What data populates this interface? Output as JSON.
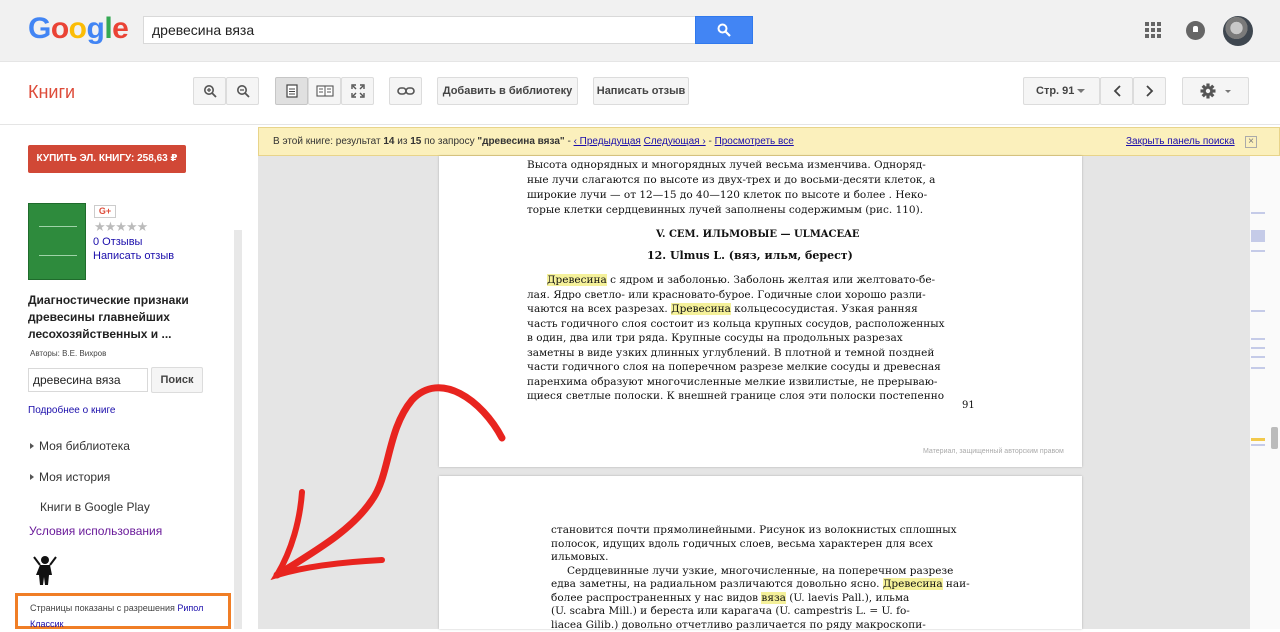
{
  "header": {
    "search_value": "древесина вяза"
  },
  "toolbar": {
    "section_title": "Книги",
    "add_library": "Добавить в библиотеку",
    "write_review": "Написать отзыв",
    "page_label": "Стр. 91"
  },
  "sidebar": {
    "buy_button": "КУПИТЬ ЭЛ. КНИГУ: 258,63 ₽",
    "gplus": "G+",
    "stars": "★★★★★",
    "reviews_count": "0 Отзывы",
    "write_review": "Написать отзыв",
    "book_title": "Диагностические признаки древесины главнейших лесохозяйственных и ...",
    "authors": "Авторы: В.Е. Вихров",
    "search_value": "древесина вяза",
    "search_button": "Поиск",
    "about_link": "Подробнее о книге",
    "nav": [
      "Моя библиотека",
      "Моя история",
      "Книги в Google Play"
    ],
    "terms": "Условия использования",
    "permission_text": "Страницы показаны с разрешения",
    "publisher": "Рипол Классик"
  },
  "results_bar": {
    "prefix": "В этой книге: результат",
    "current": "14",
    "of": "из",
    "total": "15",
    "query_prefix": "по запросу",
    "query": "\"древесина вяза\"",
    "prev": "‹ Предыдущая",
    "next": "Следующая ›",
    "view_all": "Просмотреть все",
    "close": "Закрыть панель поиска",
    "sep1": "-",
    "sep2": "-"
  },
  "page1": {
    "lines_top": [
      "Высота однорядных и многорядных лучей весьма изменчива. Одноряд-",
      "ные лучи слагаются по высоте из двух-трех и до восьми-десяти клеток, а",
      "широкие лучи — от 12—15 до 40—120 клеток по высоте и более . Неко-",
      "торые клетки сердцевинных лучей заполнены содержимым (рис. 110)."
    ],
    "family_heading": "V. СЕМ. ИЛЬМОВЫЕ — ULMACEAE",
    "genus_heading": "12. Ulmus L. (вяз, ильм, берест)",
    "hl_word": "Древесина",
    "para_line1_rest": " с ядром и заболонью. Заболонь желтая или желтовато-бе-",
    "para_line2": "лая. Ядро светло- или красновато-бурое. Годичные слои хорошо разли-",
    "para_line3_pre": "чаются на всех разрезах. ",
    "para_line3_rest": " кольцесосудистая. Узкая ранняя",
    "para_lines_rest": [
      "часть годичного слоя состоит из кольца крупных сосудов, расположенных",
      "в один, два или три ряда. Крупные сосуды на продольных разрезах",
      "заметны в виде узких длинных углублений. В плотной и темной поздней",
      "части годичного слоя на поперечном разрезе мелкие сосуды и древесная",
      "паренхима образуют многочисленные мелкие извилистые, не прерываю-",
      "щиеся светлые полоски. К внешней границе слоя эти полоски постепенно"
    ],
    "page_number": "91",
    "copyright": "Материал, защищенный авторским правом"
  },
  "page2": {
    "lines": [
      "становится почти прямолинейными. Рисунок из волокнистых сплошных",
      "полосок, идущих вдоль годичных слоев, весьма характерен для всех",
      "ильмовых."
    ],
    "l4": "Сердцевинные лучи узкие, многочисленные, на поперечном разрезе",
    "l5_pre": "едва заметны, на радиальном различаются довольно ясно. ",
    "l5_hl": "Древесина",
    "l5_post": " наи-",
    "l6_pre": "более распространенных у нас видов ",
    "l6_hl": "вяза",
    "l6_post": " (U. laevis Pall.), ильма",
    "l7": "(U. scabra Mill.) и береста или карагача (U. campestris L. = U. fo-",
    "l8": "liacea Gilib.) довольно отчетливо различается по ряду макроскопи-"
  }
}
